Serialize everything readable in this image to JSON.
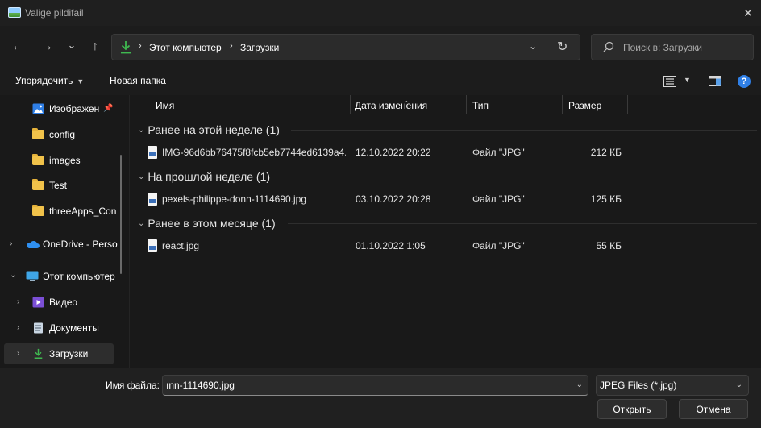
{
  "window": {
    "title": "Valige pildifail",
    "close_glyph": "✕"
  },
  "nav": {
    "back_glyph": "←",
    "forward_glyph": "→",
    "recent_glyph": "⌄",
    "up_glyph": "↑",
    "breadcrumbs": [
      {
        "label": "Этот компьютер"
      },
      {
        "label": "Загрузки"
      }
    ],
    "crumb_sep": "›",
    "dropdown_glyph": "⌄",
    "refresh_glyph": "↻",
    "search_placeholder": "Поиск в: Загрузки"
  },
  "toolbar": {
    "organize_label": "Упорядочить",
    "new_folder_label": "Новая папка",
    "caret": "▼",
    "help_label": "?"
  },
  "sidebar": {
    "items": [
      {
        "label": "Изображен",
        "icon": "pictures-icon",
        "pinned": true
      },
      {
        "label": "config",
        "icon": "folder-icon"
      },
      {
        "label": "images",
        "icon": "folder-icon"
      },
      {
        "label": "Test",
        "icon": "folder-icon"
      },
      {
        "label": "threeApps_Con",
        "icon": "folder-icon"
      },
      {
        "label": "OneDrive - Perso",
        "icon": "onedrive-icon",
        "chevron": "›"
      },
      {
        "label": "Этот компьютер",
        "icon": "computer-icon",
        "chevron": "⌄"
      },
      {
        "label": "Видео",
        "icon": "videos-icon",
        "chevron": "›"
      },
      {
        "label": "Документы",
        "icon": "documents-icon",
        "chevron": "›"
      },
      {
        "label": "Загрузки",
        "icon": "downloads-icon",
        "chevron": "›",
        "selected": true
      }
    ],
    "pin_glyph": "📌"
  },
  "columns": {
    "name": "Имя",
    "date": "Дата изменения",
    "type": "Тип",
    "size": "Размер",
    "sort_glyph": "⌃"
  },
  "groups": [
    {
      "label": "Ранее на этой неделе (1)",
      "files": [
        {
          "name": "IMG-96d6bb76475f8fcb5eb7744ed6139a4...",
          "date": "12.10.2022 20:22",
          "type": "Файл \"JPG\"",
          "size": "212 КБ"
        }
      ]
    },
    {
      "label": "На прошлой неделе (1)",
      "files": [
        {
          "name": "pexels-philippe-donn-1114690.jpg",
          "date": "03.10.2022 20:28",
          "type": "Файл \"JPG\"",
          "size": "125 КБ"
        }
      ]
    },
    {
      "label": "Ранее в этом месяце (1)",
      "files": [
        {
          "name": "react.jpg",
          "date": "01.10.2022 1:05",
          "type": "Файл \"JPG\"",
          "size": "55 КБ"
        }
      ]
    }
  ],
  "group_chevron": "⌄",
  "footer": {
    "filename_label": "Имя файла:",
    "filename_value": "ınn-1114690.jpg",
    "filetype_value": "JPEG Files (*.jpg)",
    "dropdown_glyph": "⌄",
    "open_label": "Открыть",
    "cancel_label": "Отмена"
  },
  "colors": {
    "accent_green": "#3fb950",
    "folder_yellow": "#f1c24a",
    "help_blue": "#2f7fe6"
  }
}
